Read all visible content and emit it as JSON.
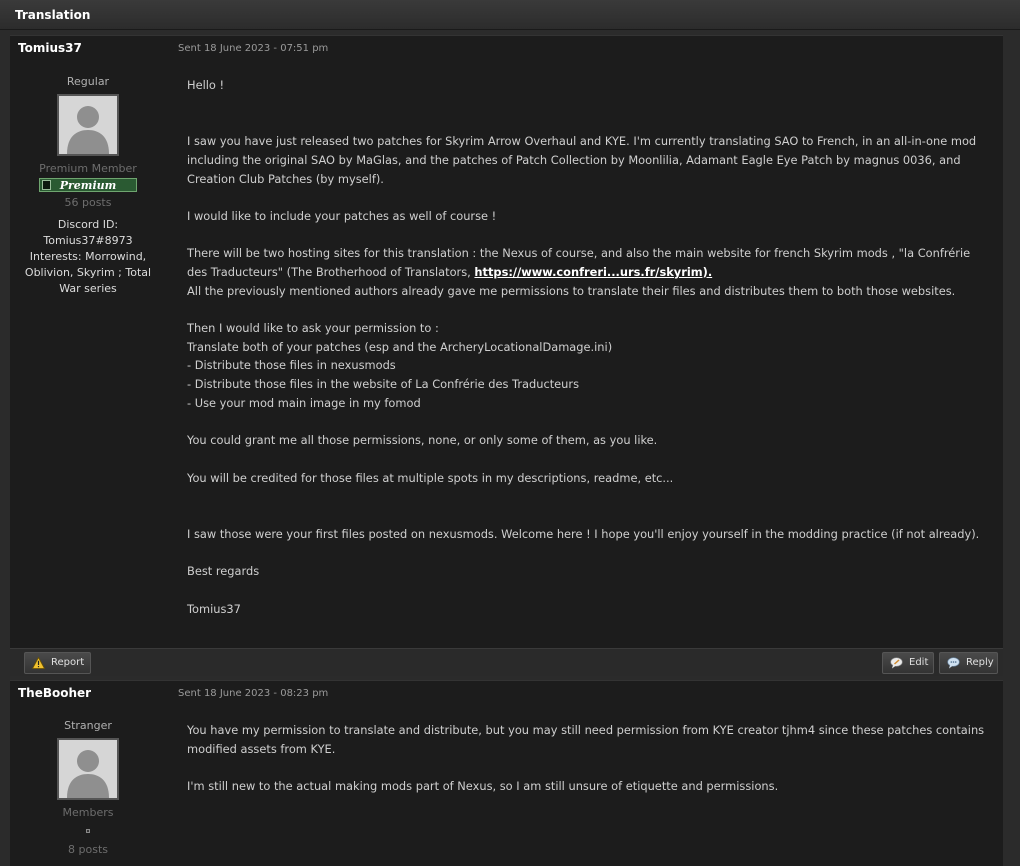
{
  "page": {
    "title": "Translation"
  },
  "posts": [
    {
      "author": "Tomius37",
      "sent": "Sent 18 June 2023 - 07:51 pm",
      "rank": "Regular",
      "group": "Premium Member",
      "badge": "Premium",
      "post_count": "56 posts",
      "extra": "Discord ID: Tomius37#8973 Interests: Morrowind, Oblivion, Skyrim ; Total War series",
      "body": {
        "p1": "Hello !",
        "p2": "I saw you have just released two patches for Skyrim Arrow Overhaul and KYE. I'm currently translating SAO to French, in an all-in-one mod including the original SAO by MaGlas, and the patches of Patch Collection by Moonlilia, Adamant Eagle Eye Patch by magnus 0036, and Creation Club Patches (by myself).",
        "p3": "I would like to include your patches as well of course !",
        "p4a": "There will be two hosting sites for this translation : the Nexus of course, and also the main website for french Skyrim mods , \"la Confrérie des Traducteurs\" (The Brotherhood of Translators, ",
        "p4link": "https://www.confreri...urs.fr/skyrim).",
        "p4b": "All the previously mentioned authors already gave me permissions to translate their files and distributes them to both those websites.",
        "p5a": "Then I would like to ask your permission to :",
        "p5b": "Translate both of your patches (esp and the ArcheryLocationalDamage.ini)",
        "p5c": "- Distribute those files in nexusmods",
        "p5d": "- Distribute those files in the website of La Confrérie des Traducteurs",
        "p5e": "- Use your mod main image in my fomod",
        "p6": "You could grant me all those permissions, none, or only some of them, as you like.",
        "p7": "You will be credited for those files at multiple spots in my descriptions, readme, etc...",
        "p8": "I saw those were your first files posted on nexusmods. Welcome here ! I hope you'll enjoy yourself in the modding practice (if not already).",
        "p9": "Best regards",
        "p10": "Tomius37"
      },
      "actions": {
        "report": "Report",
        "edit": "Edit",
        "reply": "Reply"
      }
    },
    {
      "author": "TheBooher",
      "sent": "Sent 18 June 2023 - 08:23 pm",
      "rank": "Stranger",
      "group": "Members",
      "post_count": "8 posts",
      "body": {
        "p1": "You have my permission to translate and distribute, but you may still need permission from KYE creator tjhm4 since these patches contains modified assets from KYE.",
        "p2": "I'm still new to the actual making mods part of Nexus, so I am still unsure of etiquette and permissions."
      }
    }
  ]
}
